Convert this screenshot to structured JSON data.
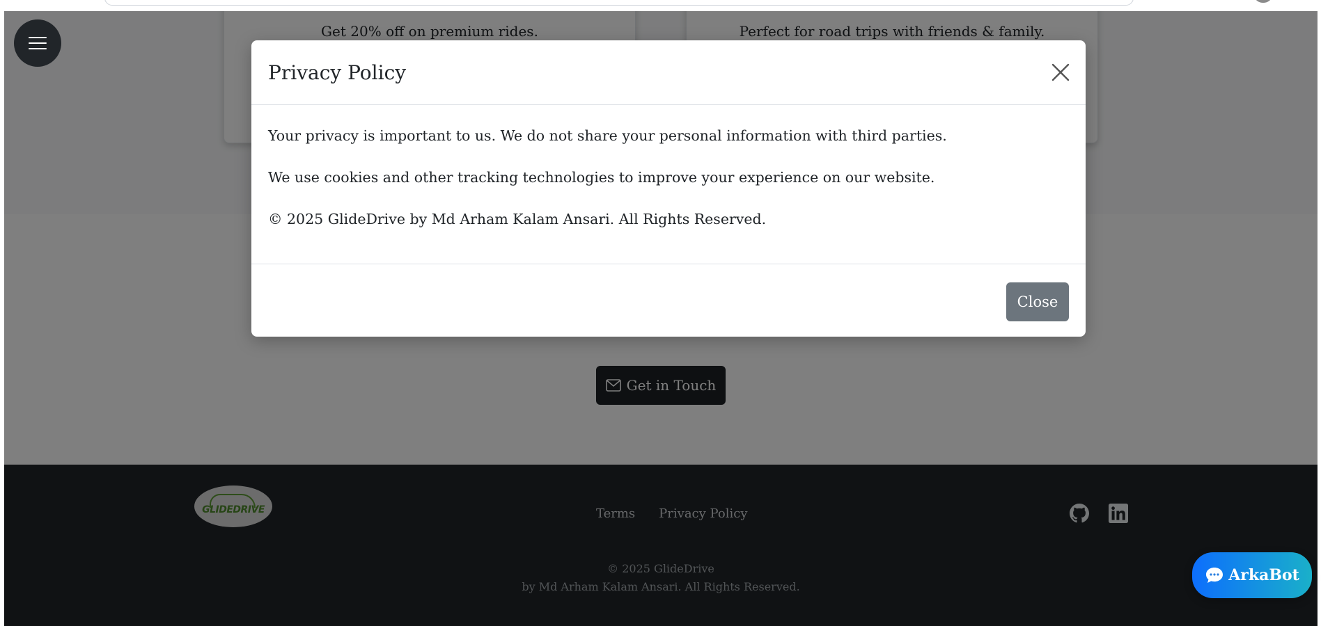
{
  "offers": {
    "card1_text": "Get 20% off on premium rides.",
    "card2_text": "Perfect for road trips with friends & family."
  },
  "contact": {
    "button_label": "Get in Touch",
    "button_icon": "envelope-icon"
  },
  "footer": {
    "logo_text": "GLIDEDRIVE",
    "links": [
      "Terms",
      "Privacy Policy"
    ],
    "social": [
      "github-icon",
      "linkedin-icon"
    ],
    "copyright_line1": "© 2025 GlideDrive",
    "copyright_line2": "by Md Arham Kalam Ansari. All Rights Reserved."
  },
  "chatbot": {
    "label": "ArkaBot",
    "icon": "chat-bubble-icon"
  },
  "nav": {
    "menu_icon": "hamburger-menu-icon"
  },
  "modal": {
    "title": "Privacy Policy",
    "paragraphs": [
      "Your privacy is important to us. We do not share your personal information with third parties.",
      "We use cookies and other tracking technologies to improve your experience on our website.",
      "© 2025 GlideDrive by Md Arham Kalam Ansari. All Rights Reserved."
    ],
    "close_label": "Close"
  },
  "colors": {
    "footer_bg": "#212529",
    "close_button": "#6c757d",
    "chatbot_gradient_start": "#0d6efd",
    "chatbot_gradient_end": "#1ab0c9",
    "logo_green": "#4e8a2d"
  }
}
